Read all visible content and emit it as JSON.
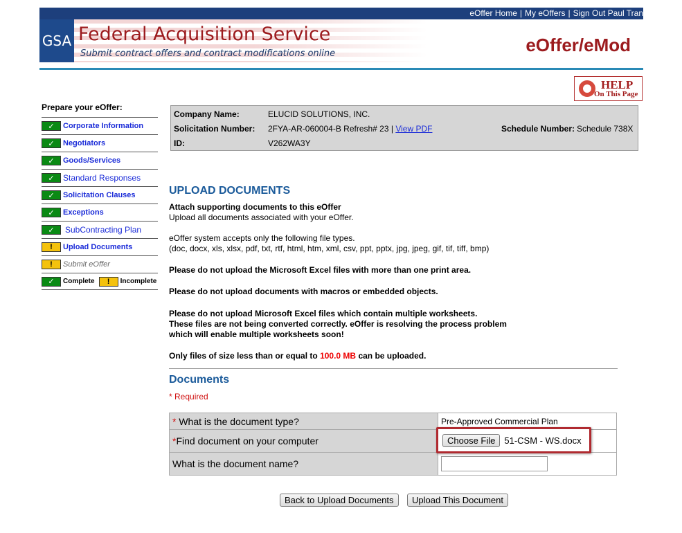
{
  "topnav": {
    "home": "eOffer Home",
    "my_offers": "My eOffers",
    "signout": "Sign Out Paul Tran",
    "sep": "|"
  },
  "header": {
    "logo_text": "GSA",
    "title": "Federal Acquisition Service",
    "subtitle": "Submit contract offers and contract modifications online",
    "app_name": "eOffer/eMod"
  },
  "help": {
    "line1": "HELP",
    "line2": "On This Page"
  },
  "sidebar": {
    "title": "Prepare your eOffer:",
    "items": [
      {
        "label": "Corporate Information",
        "status": "complete"
      },
      {
        "label": "Negotiators",
        "status": "complete"
      },
      {
        "label": "Goods/Services",
        "status": "complete"
      },
      {
        "label": "Standard Responses",
        "status": "complete"
      },
      {
        "label": "Solicitation Clauses",
        "status": "complete"
      },
      {
        "label": "Exceptions",
        "status": "complete"
      },
      {
        "label": "SubContracting Plan",
        "status": "complete"
      },
      {
        "label": "Upload Documents",
        "status": "incomplete"
      },
      {
        "label": "Submit eOffer",
        "status": "incomplete"
      }
    ],
    "legend": {
      "complete": "Complete",
      "incomplete": "Incomplete"
    },
    "check_glyph": "✓",
    "warn_glyph": "!"
  },
  "info": {
    "company_label": "Company Name:",
    "company_value": "ELUCID SOLUTIONS, INC.",
    "solicitation_label": "Solicitation Number:",
    "solicitation_value": "2FYA-AR-060004-B Refresh# 23 |",
    "view_pdf": "View PDF",
    "schedule_label": "Schedule Number:",
    "schedule_value": "Schedule 738X",
    "id_label": "ID:",
    "id_value": "V262WA3Y"
  },
  "upload": {
    "heading": "UPLOAD DOCUMENTS",
    "attach": "Attach supporting documents to this eOffer",
    "upload_all": "Upload all documents associated with your eOffer.",
    "accepts": "eOffer system accepts only the following file types.",
    "types": "(doc, docx, xls, xlsx, pdf, txt, rtf, html, htm, xml, csv, ppt, pptx, jpg, jpeg, gif, tif, tiff, bmp)",
    "warn1": "Please do not upload the Microsoft Excel files with more than one print area.",
    "warn2": "Please do not upload documents with macros or embedded objects.",
    "warn3a": "Please do not upload Microsoft Excel files which contain multiple worksheets.",
    "warn3b": "These files are not being converted correctly. eOffer is resolving the process problem",
    "warn3c": "which will enable multiple worksheets soon!",
    "size_prefix": "Only files of size less than or equal to",
    "size_value": "100.0 MB",
    "size_suffix": "can be uploaded."
  },
  "documents": {
    "heading": "Documents",
    "required": "* Required",
    "star": "*",
    "doc_type_label": " What is the document type?",
    "doc_type_value": "Pre-Approved Commercial Plan",
    "find_label": "Find document on your computer",
    "choose_file": "Choose File",
    "file_name": "51-CSM - WS.docx",
    "name_label": "What is the document name?",
    "name_value": ""
  },
  "buttons": {
    "back": "Back to Upload Documents",
    "upload": "Upload This Document"
  }
}
